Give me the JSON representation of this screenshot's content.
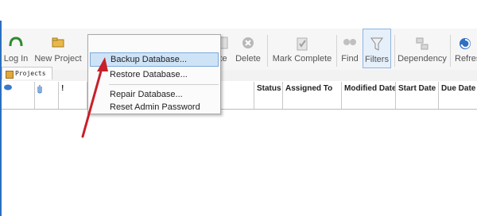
{
  "toolbar": {
    "buttons": [
      {
        "label": "Log In",
        "icon": "login-icon"
      },
      {
        "label": "New Project",
        "icon": "new-project-icon"
      },
      {
        "label": "te",
        "icon": ""
      },
      {
        "label": "Delete",
        "icon": "delete-icon"
      },
      {
        "label": "Mark Complete",
        "icon": "mark-complete-icon"
      },
      {
        "label": "Find",
        "icon": "find-icon"
      },
      {
        "label": "Filters",
        "icon": "filter-icon"
      },
      {
        "label": "Dependency",
        "icon": "dependency-icon"
      },
      {
        "label": "Refres",
        "icon": "refresh-icon"
      }
    ]
  },
  "tabs": {
    "projects": "Projects"
  },
  "grid": {
    "icon_columns": [
      "!"
    ],
    "columns": [
      "Status",
      "Assigned To",
      "Modified Date",
      "Start Date",
      "Due Date"
    ]
  },
  "menu": {
    "items": [
      "Backup Database...",
      "Restore Database...",
      "Repair Database...",
      "Reset Admin Password"
    ]
  },
  "colors": {
    "accent": "#2b6fc0",
    "highlight": "#cfe3f7",
    "arrow": "#c8202a"
  }
}
